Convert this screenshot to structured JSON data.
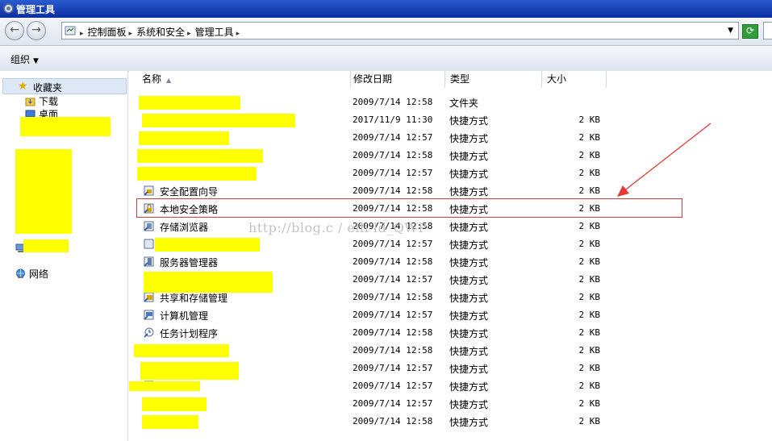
{
  "window": {
    "title": "管理工具"
  },
  "address": {
    "crumbs": [
      "控制面板",
      "系统和安全",
      "管理工具"
    ]
  },
  "toolbar": {
    "organize": "组织"
  },
  "nav": {
    "favorites": "收藏夹",
    "downloads": "下载",
    "desktop": "桌面",
    "network": "网络"
  },
  "columns": {
    "name": "名称",
    "date": "修改日期",
    "type": "类型",
    "size": "大小"
  },
  "files": [
    {
      "name": "",
      "date": "2009/7/14 12:58",
      "type": "文件夹",
      "size": ""
    },
    {
      "name": "",
      "date": "2017/11/9 11:30",
      "type": "快捷方式",
      "size": "2 KB"
    },
    {
      "name": "",
      "date": "2009/7/14 12:57",
      "type": "快捷方式",
      "size": "2 KB"
    },
    {
      "name": "",
      "date": "2009/7/14 12:58",
      "type": "快捷方式",
      "size": "2 KB"
    },
    {
      "name": "",
      "date": "2009/7/14 12:57",
      "type": "快捷方式",
      "size": "2 KB"
    },
    {
      "name": "安全配置向导",
      "date": "2009/7/14 12:58",
      "type": "快捷方式",
      "size": "2 KB"
    },
    {
      "name": "本地安全策略",
      "date": "2009/7/14 12:58",
      "type": "快捷方式",
      "size": "2 KB"
    },
    {
      "name": "存储浏览器",
      "date": "2009/7/14 12:58",
      "type": "快捷方式",
      "size": "2 KB"
    },
    {
      "name": "",
      "date": "2009/7/14 12:57",
      "type": "快捷方式",
      "size": "2 KB"
    },
    {
      "name": "服务器管理器",
      "date": "2009/7/14 12:58",
      "type": "快捷方式",
      "size": "2 KB"
    },
    {
      "name": "",
      "date": "2009/7/14 12:57",
      "type": "快捷方式",
      "size": "2 KB"
    },
    {
      "name": "共享和存储管理",
      "date": "2009/7/14 12:58",
      "type": "快捷方式",
      "size": "2 KB"
    },
    {
      "name": "计算机管理",
      "date": "2009/7/14 12:57",
      "type": "快捷方式",
      "size": "2 KB"
    },
    {
      "name": "任务计划程序",
      "date": "2009/7/14 12:58",
      "type": "快捷方式",
      "size": "2 KB"
    },
    {
      "name": "",
      "date": "2009/7/14 12:58",
      "type": "快捷方式",
      "size": "2 KB"
    },
    {
      "name": "",
      "date": "2009/7/14 12:57",
      "type": "快捷方式",
      "size": "2 KB"
    },
    {
      "name": "",
      "date": "2009/7/14 12:57",
      "type": "快捷方式",
      "size": "2 KB"
    },
    {
      "name": "",
      "date": "2009/7/14 12:57",
      "type": "快捷方式",
      "size": "2 KB"
    },
    {
      "name": "",
      "date": "2009/7/14 12:58",
      "type": "快捷方式",
      "size": "2 KB"
    }
  ],
  "watermark": "http://blog.c        /  elli    ld_QWP",
  "colors": {
    "highlight": "#ffff00",
    "annotation": "#e53935",
    "titlebar": "#1a44b8"
  }
}
